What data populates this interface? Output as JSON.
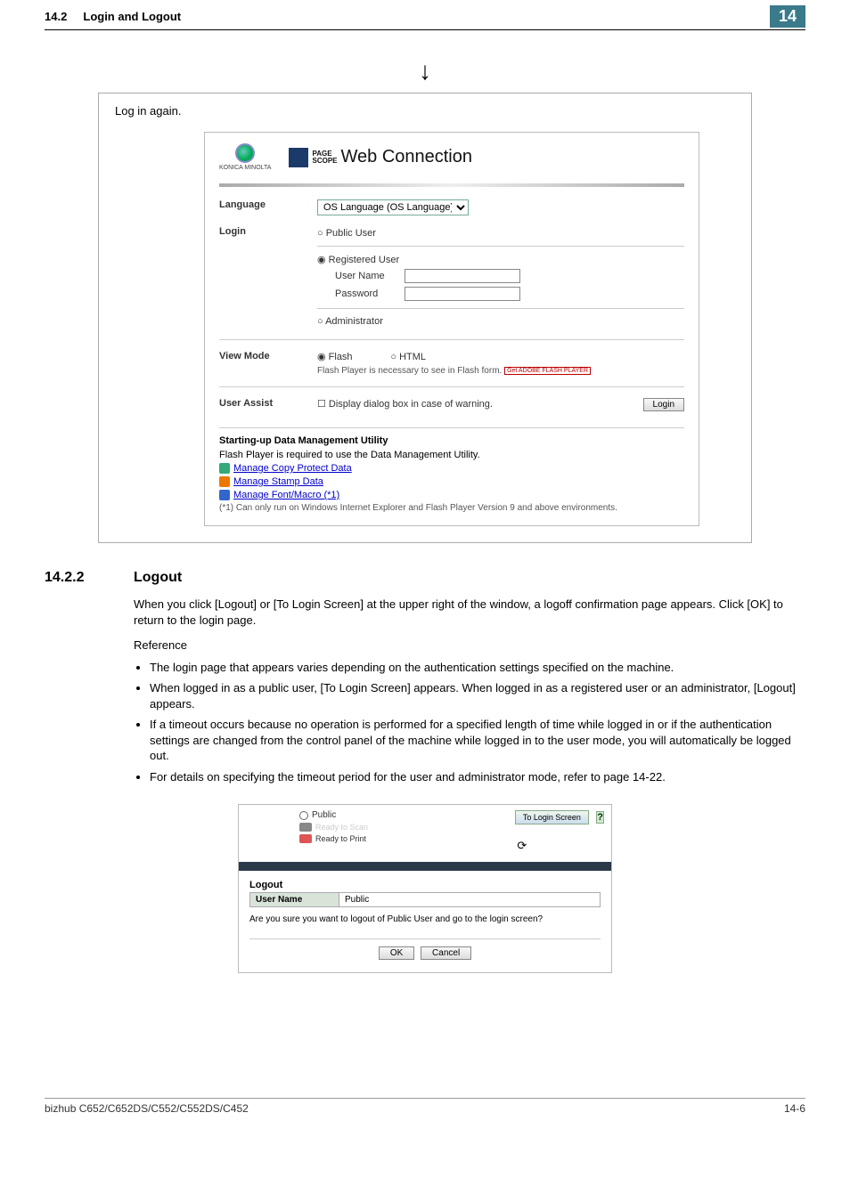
{
  "header": {
    "section": "14.2",
    "title": "Login and Logout",
    "chapter": "14"
  },
  "arrow_hint": "↓",
  "login_box": {
    "caption": "Log in again.",
    "km_brand": "KONICA MINOLTA",
    "ps_small1": "PAGE",
    "ps_small2": "SCOPE",
    "ps_main": "Web Connection",
    "rows": {
      "language_label": "Language",
      "language_value": "OS Language (OS Language)",
      "login_label": "Login",
      "public_user": "Public User",
      "registered_user": "Registered User",
      "user_name": "User Name",
      "password": "Password",
      "administrator": "Administrator",
      "viewmode_label": "View Mode",
      "flash": "Flash",
      "html": "HTML",
      "flash_note": "Flash Player is necessary to see in Flash form.",
      "flash_badge": "Get ADOBE FLASH PLAYER",
      "userassist_label": "User Assist",
      "userassist_check": "Display dialog box in case of warning.",
      "login_btn": "Login"
    },
    "dmu": {
      "title": "Starting-up Data Management Utility",
      "note1": "Flash Player is required to use the Data Management Utility.",
      "link1": "Manage Copy Protect Data",
      "link2": "Manage Stamp Data",
      "link3": "Manage Font/Macro (*1)",
      "note2": "(*1) Can only run on Windows Internet Explorer and Flash Player Version 9 and above environments."
    }
  },
  "section": {
    "num": "14.2.2",
    "title": "Logout",
    "para": "When you click [Logout] or [To Login Screen] at the upper right of the window, a logoff confirmation page appears. Click [OK] to return to the login page.",
    "reference": "Reference",
    "bullets": [
      "The login page that appears varies depending on the authentication settings specified on the machine.",
      "When logged in as a public user, [To Login Screen] appears. When logged in as a registered user or an administrator, [Logout] appears.",
      "If a timeout occurs because no operation is performed for a specified length of time while logged in or if the authentication settings are changed from the control panel of the machine while logged in to the user mode, you will automatically be logged out.",
      "For details on specifying the timeout period for the user and administrator mode, refer to page 14-22."
    ]
  },
  "logout_shot": {
    "user": "Public",
    "status1": "Ready to Scan",
    "status2": "Ready to Print",
    "to_login": "To Login Screen",
    "help": "?",
    "logout_title": "Logout",
    "th": "User Name",
    "td": "Public",
    "question": "Are you sure you want to logout of Public User and go to the login screen?",
    "ok": "OK",
    "cancel": "Cancel"
  },
  "footer": {
    "left": "bizhub C652/C652DS/C552/C552DS/C452",
    "right": "14-6"
  }
}
